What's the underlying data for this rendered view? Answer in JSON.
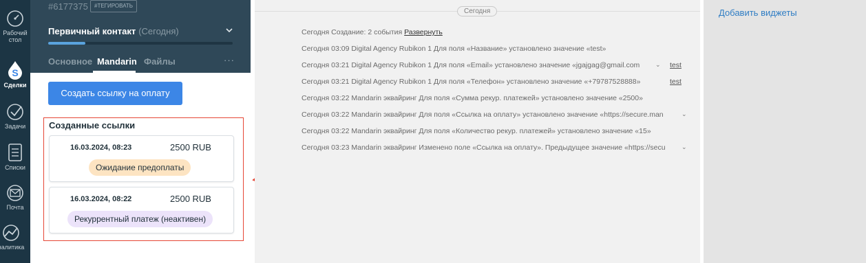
{
  "nav": {
    "items": [
      {
        "name": "dashboard",
        "label": "Рабочий стол",
        "icon": "dashboard-icon",
        "active": false
      },
      {
        "name": "deals",
        "label": "Сделки",
        "icon": "dollar-drop-icon",
        "active": true
      },
      {
        "name": "tasks",
        "label": "Задачи",
        "icon": "check-circle-icon",
        "active": false
      },
      {
        "name": "lists",
        "label": "Списки",
        "icon": "list-icon",
        "active": false
      },
      {
        "name": "mail",
        "label": "Почта",
        "icon": "mail-icon",
        "active": false
      },
      {
        "name": "analytics",
        "label": "налитика",
        "icon": "analytics-icon",
        "active": false
      }
    ]
  },
  "lead": {
    "id": "#6177375",
    "tag_button": "#ТЕГИРОВАТЬ",
    "status": "Первичный контакт",
    "status_date": "(Сегодня)",
    "progress": 0.2,
    "tabs": [
      {
        "label": "Основное",
        "active": false
      },
      {
        "label": "Mandarin",
        "active": true
      },
      {
        "label": "Файлы",
        "active": false
      }
    ],
    "more": "···"
  },
  "mandarin": {
    "create_button": "Создать ссылку на оплату",
    "links_title": "Созданные ссылки",
    "links": [
      {
        "date": "16.03.2024, 08:23",
        "amount": "2500 RUB",
        "status": "Ожидание предоплаты",
        "status_type": "pending"
      },
      {
        "date": "16.03.2024, 08:22",
        "amount": "2500 RUB",
        "status": "Рекуррентный платеж (неактивен)",
        "status_type": "inactive"
      }
    ]
  },
  "feed": {
    "today_chip": "Сегодня",
    "events": [
      {
        "text": "Сегодня Создание: 2 события ",
        "expand": "Развернуть",
        "chevron": false,
        "link": ""
      },
      {
        "text": "Сегодня 03:09 Digital Agency Rubikon 1 Для поля «Название» установлено значение «test»",
        "expand": "",
        "chevron": false,
        "link": ""
      },
      {
        "text": "Сегодня 03:21 Digital Agency Rubikon 1 Для поля «Email» установлено значение «jgajgag@gmail.com",
        "expand": "",
        "chevron": true,
        "link": "test"
      },
      {
        "text": "Сегодня 03:21 Digital Agency Rubikon 1 Для поля «Телефон» установлено значение «+79787528888»",
        "expand": "",
        "chevron": false,
        "link": "test"
      },
      {
        "text": "Сегодня 03:22 Mandarin эквайринг  Для поля «Сумма рекур. платежей» установлено значение «2500»",
        "expand": "",
        "chevron": false,
        "link": ""
      },
      {
        "text": "Сегодня 03:22 Mandarin эквайринг  Для поля «Ссылка на оплату» установлено значение «https://secure.man",
        "expand": "",
        "chevron": true,
        "link": ""
      },
      {
        "text": "Сегодня 03:22 Mandarin эквайринг  Для поля «Количество рекур. платежей» установлено значение «15»",
        "expand": "",
        "chevron": false,
        "link": ""
      },
      {
        "text": "Сегодня 03:23 Mandarin эквайринг  Изменено поле «Ссылка на оплату». Предыдущее значение «https://secu",
        "expand": "",
        "chevron": true,
        "link": ""
      }
    ]
  },
  "widgets": {
    "link": "Добавить виджеты"
  },
  "colors": {
    "accent": "#3c86e6",
    "highlight": "#e64535",
    "nav_bg": "#1c3544",
    "header_bg": "#2f4858"
  }
}
